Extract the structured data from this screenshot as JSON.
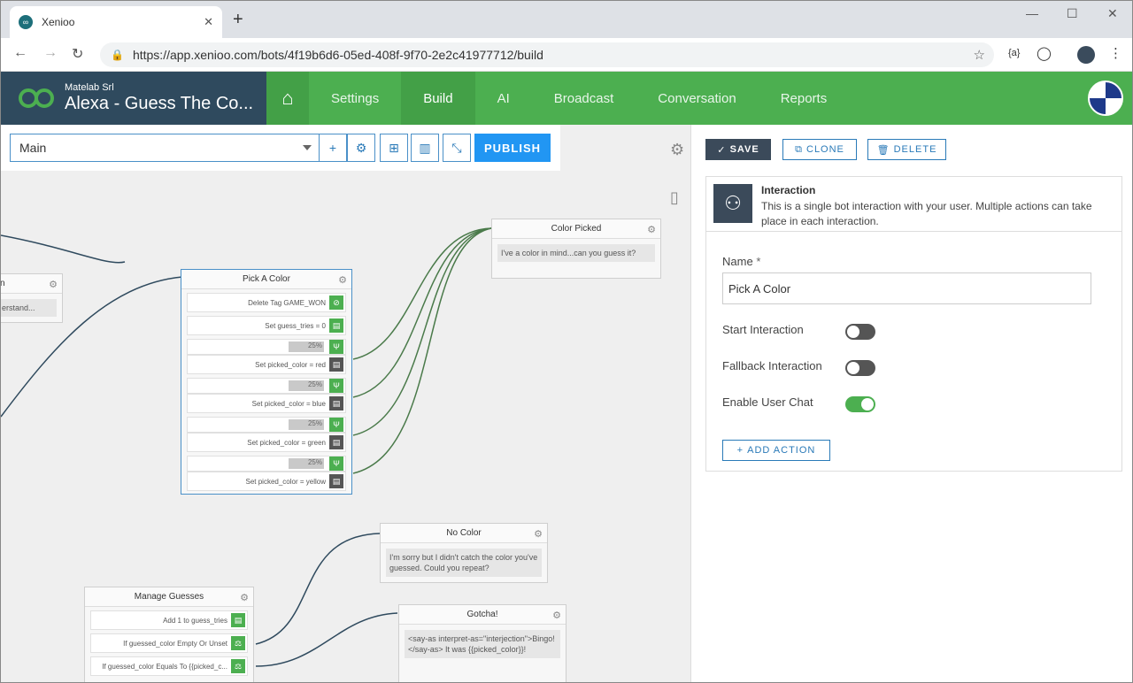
{
  "browser": {
    "tab_title": "Xenioo",
    "url": "https://app.xenioo.com/bots/4f19b6d6-05ed-408f-9f70-2e2c41977712/build"
  },
  "header": {
    "company": "Matelab Srl",
    "bot_name": "Alexa - Guess The Co...",
    "menu": [
      "Settings",
      "Build",
      "AI",
      "Broadcast",
      "Conversation",
      "Reports"
    ],
    "active_menu": "Build"
  },
  "toolbar": {
    "flow": "Main",
    "publish_label": "PUBLISH"
  },
  "nodes": {
    "left_partial": {
      "title": "n",
      "text": "erstand..."
    },
    "pick_color": {
      "title": "Pick A Color",
      "actions": [
        "Delete Tag GAME_WON",
        "Set guess_tries = 0"
      ],
      "branches": [
        {
          "pct": "25%",
          "label": "Set picked_color = red"
        },
        {
          "pct": "25%",
          "label": "Set picked_color = blue"
        },
        {
          "pct": "25%",
          "label": "Set picked_color = green"
        },
        {
          "pct": "25%",
          "label": "Set picked_color = yellow"
        }
      ]
    },
    "color_picked": {
      "title": "Color Picked",
      "text": "I've a color in mind...can you guess it?"
    },
    "no_color": {
      "title": "No Color",
      "text": "I'm sorry but I didn't catch the color you've guessed. Could you repeat?"
    },
    "manage_guesses": {
      "title": "Manage Guesses",
      "actions": [
        "Add 1 to guess_tries",
        "If guessed_color Empty Or Unset",
        "If guessed_color Equals To {{picked_c..."
      ]
    },
    "gotcha": {
      "title": "Gotcha!",
      "text": "<say-as interpret-as=\"interjection\">Bingo!</say-as> It was {{picked_color}}!"
    }
  },
  "props": {
    "save_label": "SAVE",
    "clone_label": "CLONE",
    "delete_label": "DELETE",
    "card_title": "Interaction",
    "card_desc": "This is a single bot interaction with your user. Multiple actions can take place in each interaction.",
    "name_label": "Name",
    "name_required": "*",
    "name_value": "Pick A Color",
    "start_label": "Start Interaction",
    "start_on": false,
    "fallback_label": "Fallback Interaction",
    "fallback_on": false,
    "chat_label": "Enable User Chat",
    "chat_on": true,
    "add_action_label": "ADD ACTION"
  },
  "colors": {
    "brand_green": "#4caf50",
    "brand_dark": "#2f4a5e",
    "accent_blue": "#2196f3"
  }
}
